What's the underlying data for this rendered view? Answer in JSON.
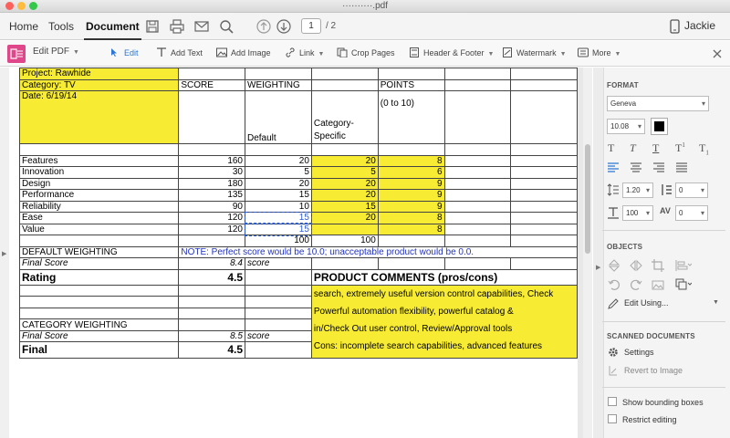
{
  "window": {
    "title": "··········.pdf"
  },
  "menubar": {
    "items": [
      "Home",
      "Tools",
      "Document"
    ],
    "page_current": "1",
    "page_total": "/ 2",
    "user": "Jackie"
  },
  "editbar": {
    "edit_pdf": "Edit PDF",
    "edit": "Edit",
    "add_text": "Add Text",
    "add_image": "Add Image",
    "link": "Link",
    "crop_pages": "Crop Pages",
    "header_footer": "Header & Footer",
    "watermark": "Watermark",
    "more": "More"
  },
  "sheet": {
    "r1": {
      "a": "Project: Rawhide"
    },
    "r2": {
      "a": "Category: TV",
      "b": "SCORE",
      "c": "WEIGHTING",
      "e": "POINTS"
    },
    "r3": {
      "a": "Date: 6/19/14",
      "e": "(0 to 10)"
    },
    "r4": {
      "d": "Category-"
    },
    "r5": {
      "c": "Default",
      "d": "Specific"
    },
    "rows": [
      {
        "name": "Features",
        "score": "160",
        "def": "20",
        "spec": "20",
        "pts": "8"
      },
      {
        "name": "Innovation",
        "score": "30",
        "def": "5",
        "spec": "5",
        "pts": "6"
      },
      {
        "name": "Design",
        "score": "180",
        "def": "20",
        "spec": "20",
        "pts": "9"
      },
      {
        "name": "Performance",
        "score": "135",
        "def": "15",
        "spec": "20",
        "pts": "9"
      },
      {
        "name": "Reliability",
        "score": "90",
        "def": "10",
        "spec": "15",
        "pts": "9"
      },
      {
        "name": "Ease",
        "score": "120",
        "def": "15",
        "spec": "20",
        "pts": "8"
      },
      {
        "name": "Value",
        "score": "120",
        "def": "15",
        "spec": "",
        "pts": "8"
      }
    ],
    "totals": {
      "def": "100",
      "spec": "100"
    },
    "default_weighting": "DEFAULT WEIGHTING",
    "note": "NOTE: Perfect score would be 10.0; unacceptable product would be 0.0.",
    "final_score_label": "Final Score",
    "final_score_default": "8.4",
    "score_word": "score",
    "rating_label": "Rating",
    "rating_value": "4.5",
    "comments_title": "PRODUCT COMMENTS (pros/cons)",
    "comments_line1": "search, extremely useful version control capabilities, Check",
    "comments_line2": "Powerful automation flexibility, powerful  catalog &",
    "comments_line3": "in/Check Out user control,  Review/Approval tools",
    "comments_line4": "Cons: incomplete search capabilities,  advanced features",
    "category_weighting": "CATEGORY WEIGHTING",
    "final_score_category": "8.5",
    "final_label": "Final",
    "final_value": "4.5"
  },
  "panel": {
    "format_title": "FORMAT",
    "font": "Geneva",
    "font_size": "10.08",
    "line_spacing": "1.20",
    "para_spacing": "0",
    "scale": "100",
    "char_spacing": "0",
    "objects_title": "OBJECTS",
    "edit_using": "Edit Using...",
    "scanned_title": "SCANNED DOCUMENTS",
    "settings": "Settings",
    "revert": "Revert to Image",
    "show_boxes": "Show bounding boxes",
    "restrict": "Restrict editing"
  },
  "colors": {
    "highlight": "#f7ec33",
    "accent": "#2a76d2",
    "editpdf": "#e0468a"
  }
}
